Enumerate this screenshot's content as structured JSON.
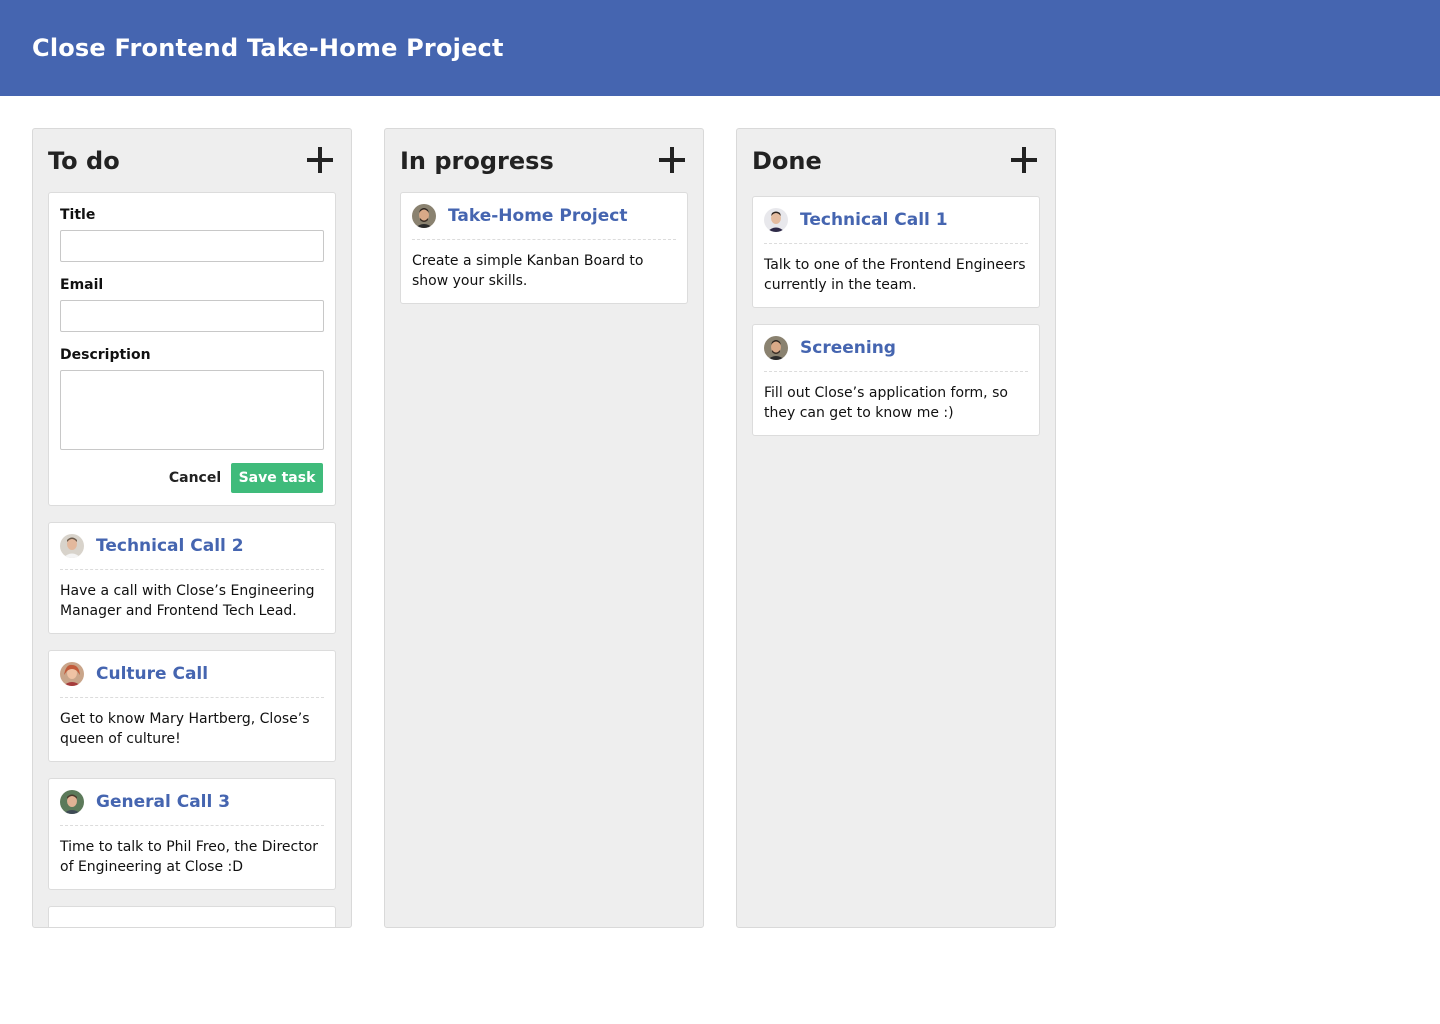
{
  "app": {
    "title": "Close Frontend Take-Home Project"
  },
  "colors": {
    "header": "#4565b0",
    "card_title": "#4565b0",
    "save_button": "#3fbb7b",
    "column_bg": "#eeeeee"
  },
  "columns": [
    {
      "title": "To do",
      "add_icon": "plus-icon",
      "form": {
        "title_label": "Title",
        "title_value": "",
        "email_label": "Email",
        "email_value": "",
        "description_label": "Description",
        "description_value": "",
        "cancel_label": "Cancel",
        "save_label": "Save task"
      },
      "cards": [
        {
          "title": "Technical Call 2",
          "description": "Have a call with Close’s Engineering Manager and Frontend Tech Lead.",
          "avatar": "avatar-icon"
        },
        {
          "title": "Culture Call",
          "description": "Get to know Mary Hartberg, Close’s queen of culture!",
          "avatar": "avatar-icon"
        },
        {
          "title": "General Call 3",
          "description": "Time to talk to Phil Freo, the Director of Engineering at Close :D",
          "avatar": "avatar-icon"
        }
      ]
    },
    {
      "title": "In progress",
      "add_icon": "plus-icon",
      "cards": [
        {
          "title": "Take-Home Project",
          "description": "Create a simple Kanban Board to show your skills.",
          "avatar": "avatar-icon"
        }
      ]
    },
    {
      "title": "Done",
      "add_icon": "plus-icon",
      "cards": [
        {
          "title": "Technical Call 1",
          "description": "Talk to one of the Frontend Engineers currently in the team.",
          "avatar": "avatar-icon"
        },
        {
          "title": "Screening",
          "description": "Fill out Close’s application form, so they can get to know me :)",
          "avatar": "avatar-icon"
        }
      ]
    }
  ]
}
